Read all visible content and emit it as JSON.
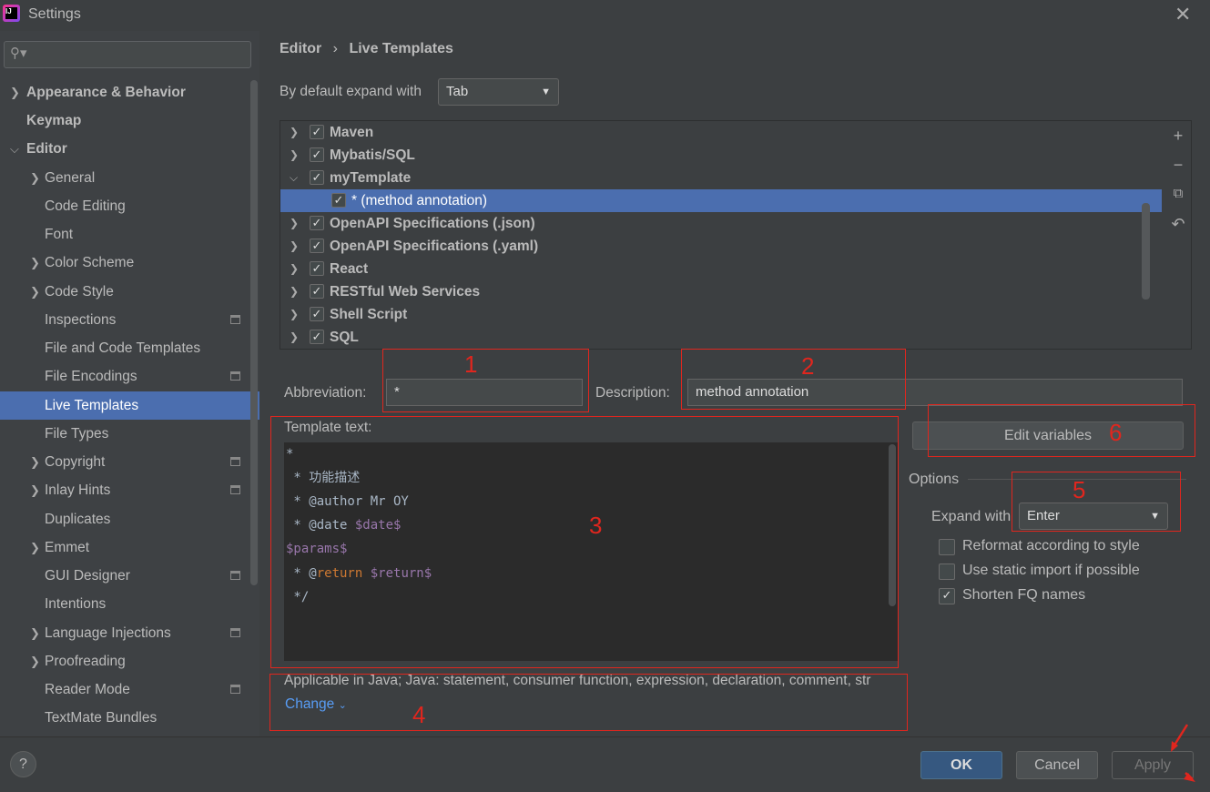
{
  "window": {
    "title": "Settings",
    "close_icon": "close-icon",
    "app_icon": "intellij-icon"
  },
  "sidebar": {
    "search_placeholder": "",
    "items": [
      {
        "label": "Appearance & Behavior",
        "level": 0,
        "chevron": "right",
        "bold": true
      },
      {
        "label": "Keymap",
        "level": 0,
        "bold": true
      },
      {
        "label": "Editor",
        "level": 0,
        "chevron": "down",
        "bold": true
      },
      {
        "label": "General",
        "level": 1,
        "chevron": "right"
      },
      {
        "label": "Code Editing",
        "level": 1
      },
      {
        "label": "Font",
        "level": 1
      },
      {
        "label": "Color Scheme",
        "level": 1,
        "chevron": "right"
      },
      {
        "label": "Code Style",
        "level": 1,
        "chevron": "right"
      },
      {
        "label": "Inspections",
        "level": 1,
        "badge": true
      },
      {
        "label": "File and Code Templates",
        "level": 1
      },
      {
        "label": "File Encodings",
        "level": 1,
        "badge": true
      },
      {
        "label": "Live Templates",
        "level": 1,
        "selected": true
      },
      {
        "label": "File Types",
        "level": 1
      },
      {
        "label": "Copyright",
        "level": 1,
        "chevron": "right",
        "badge": true
      },
      {
        "label": "Inlay Hints",
        "level": 1,
        "chevron": "right",
        "badge": true
      },
      {
        "label": "Duplicates",
        "level": 1
      },
      {
        "label": "Emmet",
        "level": 1,
        "chevron": "right"
      },
      {
        "label": "GUI Designer",
        "level": 1,
        "badge": true
      },
      {
        "label": "Intentions",
        "level": 1
      },
      {
        "label": "Language Injections",
        "level": 1,
        "chevron": "right",
        "badge": true
      },
      {
        "label": "Proofreading",
        "level": 1,
        "chevron": "right"
      },
      {
        "label": "Reader Mode",
        "level": 1,
        "badge": true
      },
      {
        "label": "TextMate Bundles",
        "level": 1
      }
    ]
  },
  "breadcrumb": {
    "parent": "Editor",
    "sep": "›",
    "current": "Live Templates"
  },
  "expand_default": {
    "label": "By default expand with",
    "value": "Tab"
  },
  "templates": [
    {
      "label": "Maven",
      "checked": true,
      "chevron": "right"
    },
    {
      "label": "Mybatis/SQL",
      "checked": true,
      "chevron": "right"
    },
    {
      "label": "myTemplate",
      "checked": true,
      "chevron": "down"
    },
    {
      "label": "* (method annotation)",
      "checked": true,
      "child": true,
      "selected": true
    },
    {
      "label": "OpenAPI Specifications (.json)",
      "checked": true,
      "chevron": "right"
    },
    {
      "label": "OpenAPI Specifications (.yaml)",
      "checked": true,
      "chevron": "right"
    },
    {
      "label": "React",
      "checked": true,
      "chevron": "right"
    },
    {
      "label": "RESTful Web Services",
      "checked": true,
      "chevron": "right"
    },
    {
      "label": "Shell Script",
      "checked": true,
      "chevron": "right"
    },
    {
      "label": "SQL",
      "checked": true,
      "chevron": "right"
    }
  ],
  "toolbar": {
    "add": "+",
    "remove": "−",
    "copy": "⧉",
    "revert": "↶"
  },
  "abbreviation": {
    "label": "Abbreviation:",
    "value": "*"
  },
  "description": {
    "label": "Description:",
    "value": "method annotation"
  },
  "template_text": {
    "label": "Template text:"
  },
  "applicable": {
    "text": "Applicable in Java; Java: statement, consumer function, expression, declaration, comment, str",
    "change": "Change"
  },
  "edit_variables": "Edit variables",
  "options": {
    "title": "Options",
    "expand_label": "Expand with",
    "expand_value": "Enter",
    "checks": [
      {
        "label": "Reformat according to style",
        "checked": false
      },
      {
        "label": "Use static import if possible",
        "checked": false
      },
      {
        "label": "Shorten FQ names",
        "checked": true
      }
    ]
  },
  "annotations": [
    "1",
    "2",
    "3",
    "4",
    "5",
    "6"
  ],
  "footer": {
    "help": "?",
    "ok": "OK",
    "cancel": "Cancel",
    "apply": "Apply"
  },
  "colors": {
    "accent": "#4b6eaf",
    "annotation": "#e0261e",
    "link": "#589df6"
  }
}
